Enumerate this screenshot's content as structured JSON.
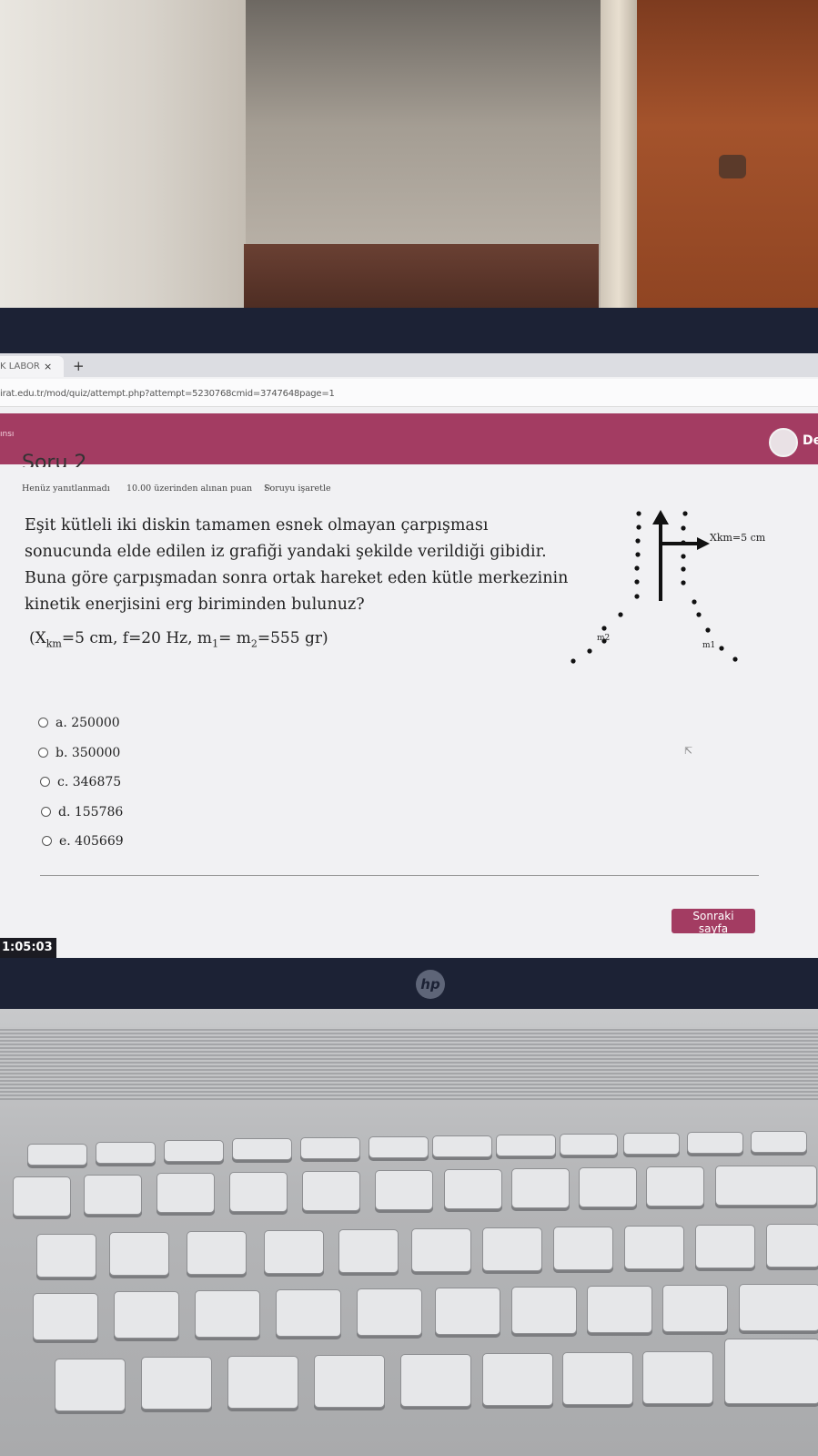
{
  "browser": {
    "tab_title": "K LABOR",
    "tab_close": "×",
    "new_tab": "+",
    "url": "irat.edu.tr/mod/quiz/attempt.php?attempt=5230768cmid=3747648page=1"
  },
  "site": {
    "brand_fragment": "ınsı",
    "user_fragment": "De"
  },
  "question": {
    "number_label": "Soru 2",
    "status": "Henüz yanıtlanmadı",
    "points": "10.00 üzerinden alınan puan",
    "flag_label": "Soruyu işaretle",
    "text_lines": [
      "Eşit kütleli iki diskin tamamen esnek olmayan çarpışması",
      "sonucunda elde edilen iz grafiği yandaki şekilde verildiği gibidir.",
      "Buna göre çarpışmadan sonra ortak hareket eden kütle merkezinin",
      "kinetik enerjisini erg biriminden bulunuz?"
    ],
    "givens": {
      "open": "(X",
      "xkm_sub": "km",
      "xkm_rest": "=5 cm, f=20 Hz, m",
      "m1_sub": "1",
      "mid": "= m",
      "m2_sub": "2",
      "close": "=555 gr)"
    },
    "figure": {
      "xkm_label": "Xkm=5 cm",
      "m_left_label": "m2",
      "m_right_label": "m1"
    }
  },
  "options": [
    {
      "label": "a. 250000",
      "selected": false
    },
    {
      "label": "b. 350000",
      "selected": false
    },
    {
      "label": "c. 346875",
      "selected": false
    },
    {
      "label": "d. 155786",
      "selected": false
    },
    {
      "label": "e. 405669",
      "selected": false
    }
  ],
  "nav": {
    "next_label": "Sonraki sayfa"
  },
  "timer": "1:05:03",
  "laptop": {
    "brand": "hp"
  },
  "colors": {
    "header": "#a33c62",
    "button": "#a33c62",
    "bezel": "#1c2235"
  }
}
